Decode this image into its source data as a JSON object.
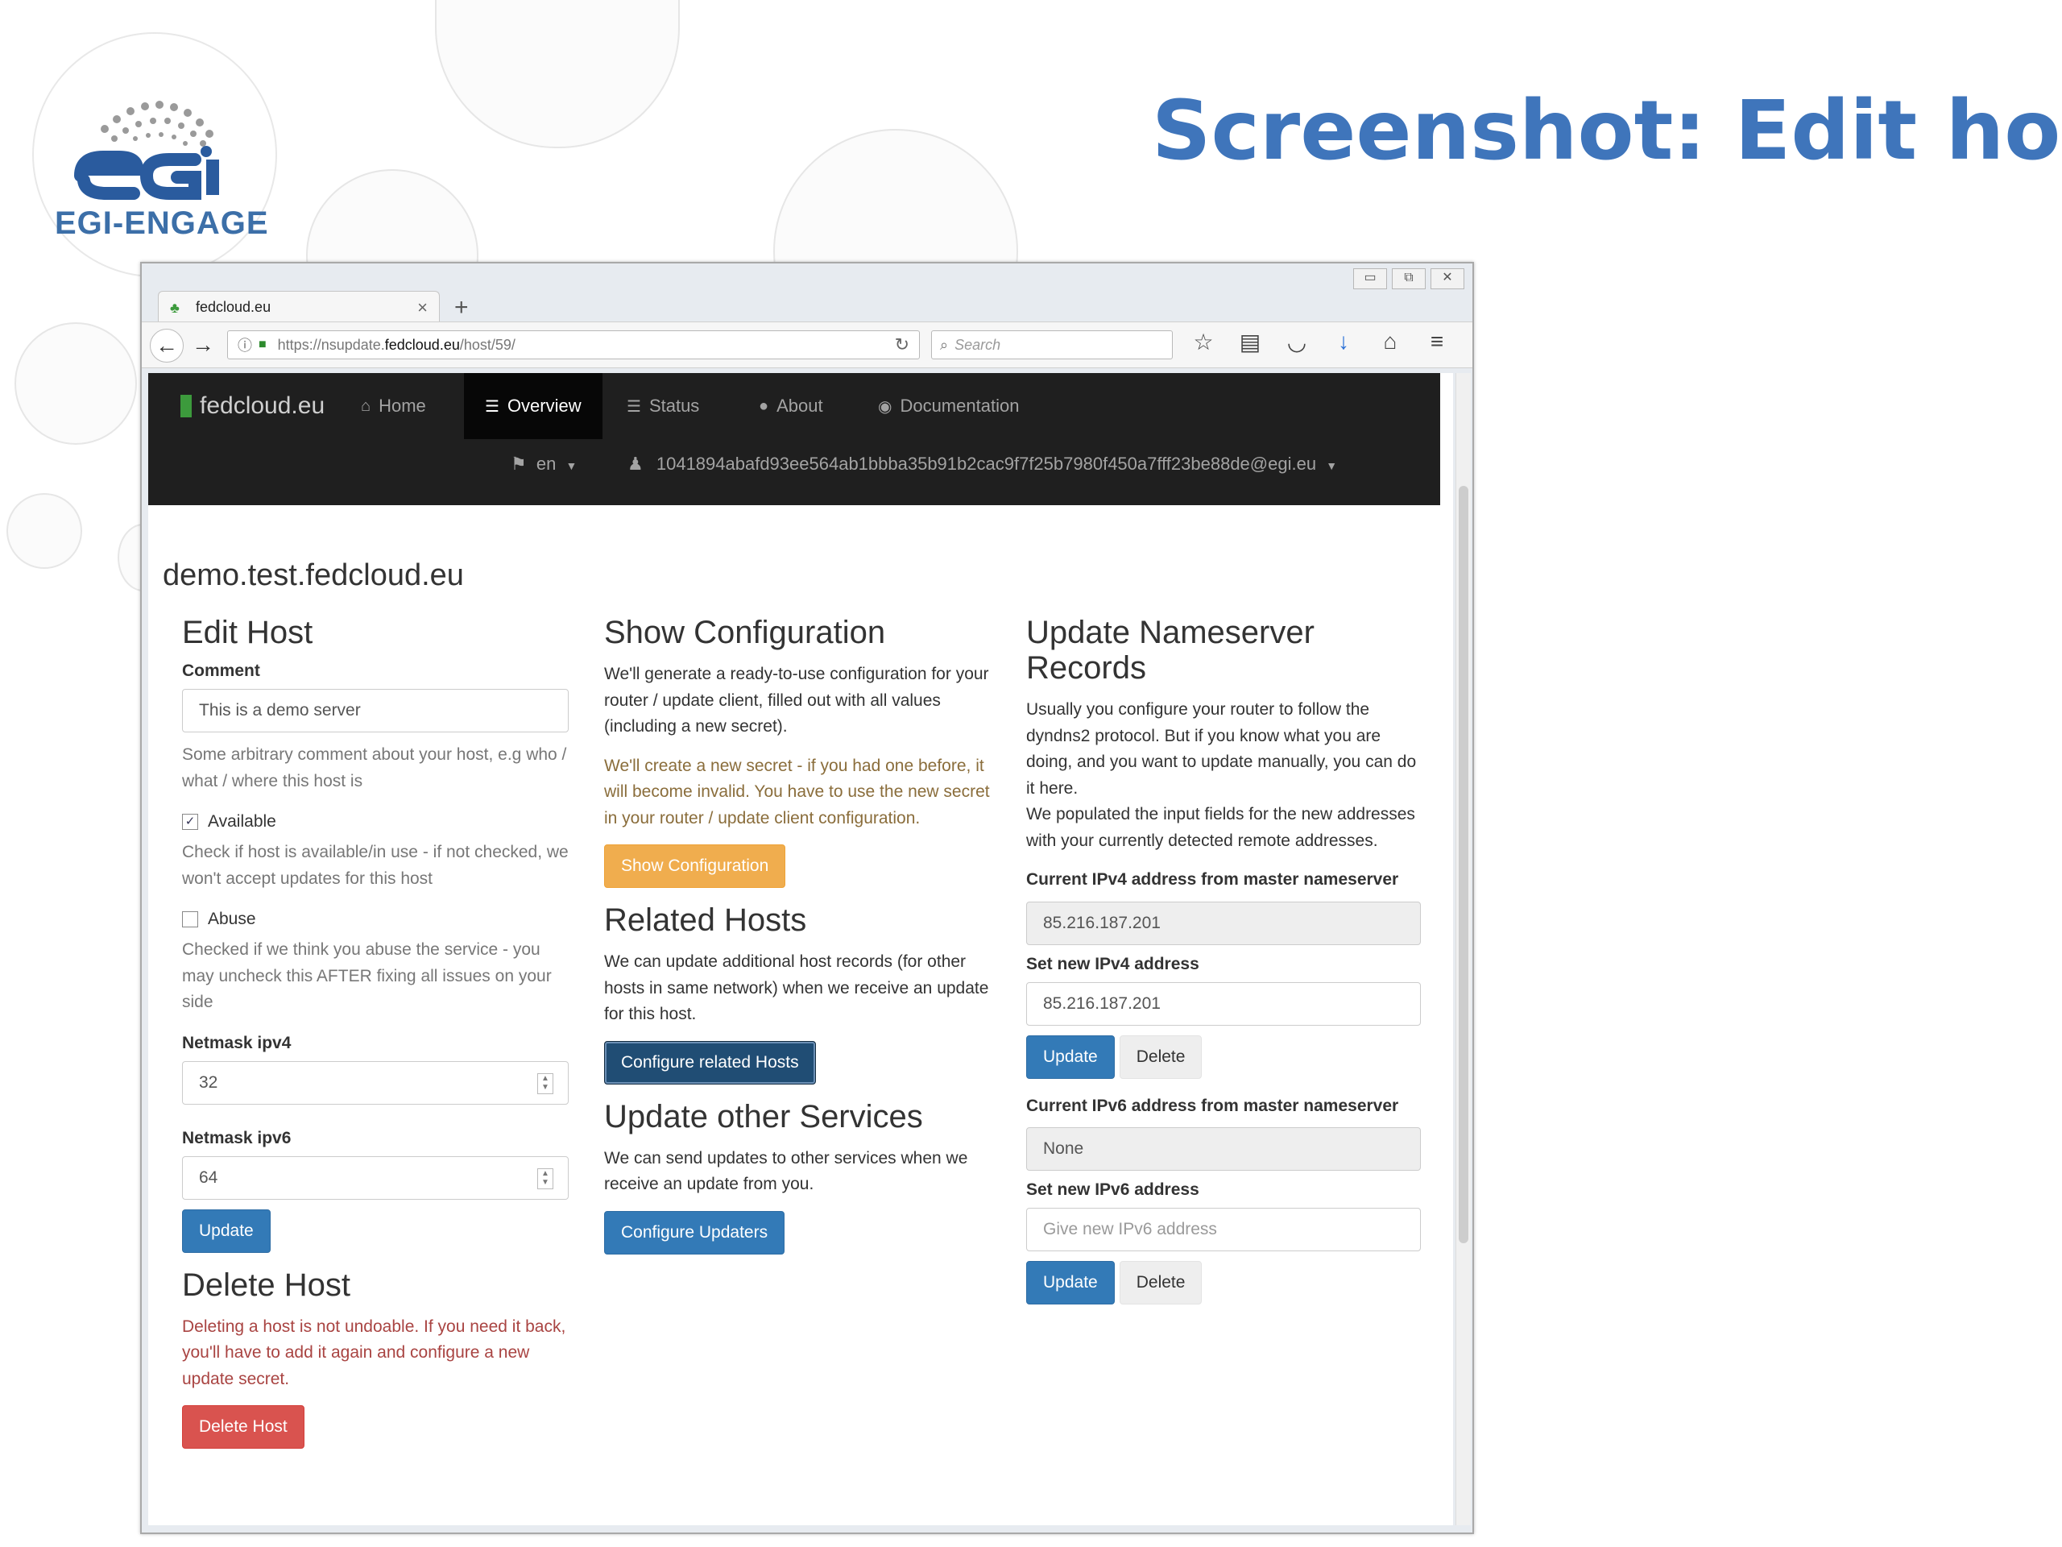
{
  "slide": {
    "logo_text": "EGI-ENGAGE",
    "title": "Screenshot: Edit host"
  },
  "browser": {
    "tab_label": "fedcloud.eu",
    "url_prefix": "https://nsupdate.",
    "url_host": "fedcloud.eu",
    "url_path": "/host/59/",
    "search_placeholder": "Search"
  },
  "site_nav": {
    "brand": "fedcloud.eu",
    "items": [
      {
        "label": "Home",
        "icon": "home-icon",
        "active": false
      },
      {
        "label": "Overview",
        "icon": "list-icon",
        "active": true
      },
      {
        "label": "Status",
        "icon": "list-icon",
        "active": false
      },
      {
        "label": "About",
        "icon": "comment-icon",
        "active": false
      },
      {
        "label": "Documentation",
        "icon": "eye-icon",
        "active": false
      }
    ],
    "language": "en",
    "user": "1041894abafd93ee564ab1bbba35b91b2cac9f7f25b7980f450a7fff23be88de@egi.eu"
  },
  "page": {
    "host_name": "demo.test.fedcloud.eu",
    "edit_host": {
      "heading": "Edit Host",
      "comment_label": "Comment",
      "comment_value": "This is a demo server",
      "comment_help": "Some arbitrary comment about your host, e.g who / what / where this host is",
      "available_label": "Available",
      "available_checked": true,
      "available_help": "Check if host is available/in use - if not checked, we won't accept updates for this host",
      "abuse_label": "Abuse",
      "abuse_checked": false,
      "abuse_help": "Checked if we think you abuse the service - you may uncheck this AFTER fixing all issues on your side",
      "netmask_v4_label": "Netmask ipv4",
      "netmask_v4_value": "32",
      "netmask_v6_label": "Netmask ipv6",
      "netmask_v6_value": "64",
      "update_button": "Update"
    },
    "delete_host": {
      "heading": "Delete Host",
      "warning": "Deleting a host is not undoable. If you need it back, you'll have to add it again and configure a new update secret.",
      "button": "Delete Host"
    },
    "show_configuration": {
      "heading": "Show Configuration",
      "text": "We'll generate a ready-to-use configuration for your router / update client, filled out with all values (including a new secret).",
      "warning": "We'll create a new secret - if you had one before, it will become invalid. You have to use the new secret in your router / update client configuration.",
      "button": "Show Configuration"
    },
    "related_hosts": {
      "heading": "Related Hosts",
      "text": "We can update additional host records (for other hosts in same network) when we receive an update for this host.",
      "button": "Configure related Hosts"
    },
    "other_services": {
      "heading": "Update other Services",
      "text": "We can send updates to other services when we receive an update from you.",
      "button": "Configure Updaters"
    },
    "nameserver": {
      "heading": "Update Nameserver Records",
      "text1": "Usually you configure your router to follow the dyndns2 protocol. But if you know what you are doing, and you want to update manually, you can do it here.",
      "text2": "We populated the input fields for the new addresses with your currently detected remote addresses.",
      "ipv4_current_label": "Current IPv4 address from master nameserver",
      "ipv4_current_value": "85.216.187.201",
      "ipv4_new_label": "Set new IPv4 address",
      "ipv4_new_value": "85.216.187.201",
      "ipv6_current_label": "Current IPv6 address from master nameserver",
      "ipv6_current_value": "None",
      "ipv6_new_label": "Set new IPv6 address",
      "ipv6_new_placeholder": "Give new IPv6 address",
      "update_button": "Update",
      "delete_button": "Delete"
    }
  }
}
